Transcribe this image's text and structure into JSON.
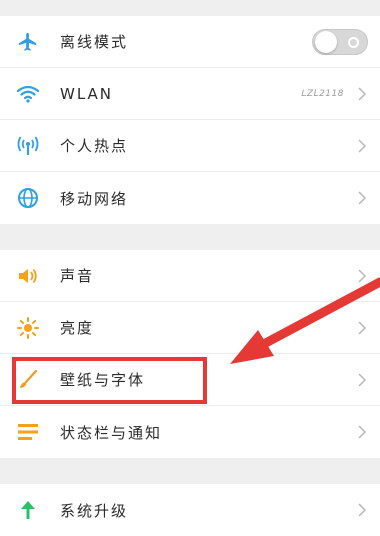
{
  "colors": {
    "accent_blue": "#2f9fe6",
    "sound_orange": "#f6a11a",
    "wallpaper_orange": "#f39a1e",
    "upgrade_green": "#2bbf6a",
    "annotation_red": "#e53935"
  },
  "groups": [
    {
      "rows": [
        {
          "label": "离线模式",
          "icon": "airplane-icon",
          "control": "toggle",
          "toggle_on": false
        },
        {
          "label": "WLAN",
          "icon": "wifi-icon",
          "value": "LZL2118",
          "control": "chevron"
        },
        {
          "label": "个人热点",
          "icon": "hotspot-icon",
          "control": "chevron"
        },
        {
          "label": "移动网络",
          "icon": "globe-icon",
          "control": "chevron"
        }
      ]
    },
    {
      "rows": [
        {
          "label": "声音",
          "icon": "speaker-icon",
          "control": "chevron"
        },
        {
          "label": "亮度",
          "icon": "sun-icon",
          "control": "chevron"
        },
        {
          "label": "壁纸与字体",
          "icon": "paintbrush-icon",
          "control": "chevron",
          "highlighted": true
        },
        {
          "label": "状态栏与通知",
          "icon": "list-icon",
          "control": "chevron"
        }
      ]
    },
    {
      "rows": [
        {
          "label": "系统升级",
          "icon": "up-arrow-icon",
          "control": "chevron"
        }
      ]
    }
  ],
  "annotation": {
    "type": "red arrow pointing to highlighted row"
  }
}
